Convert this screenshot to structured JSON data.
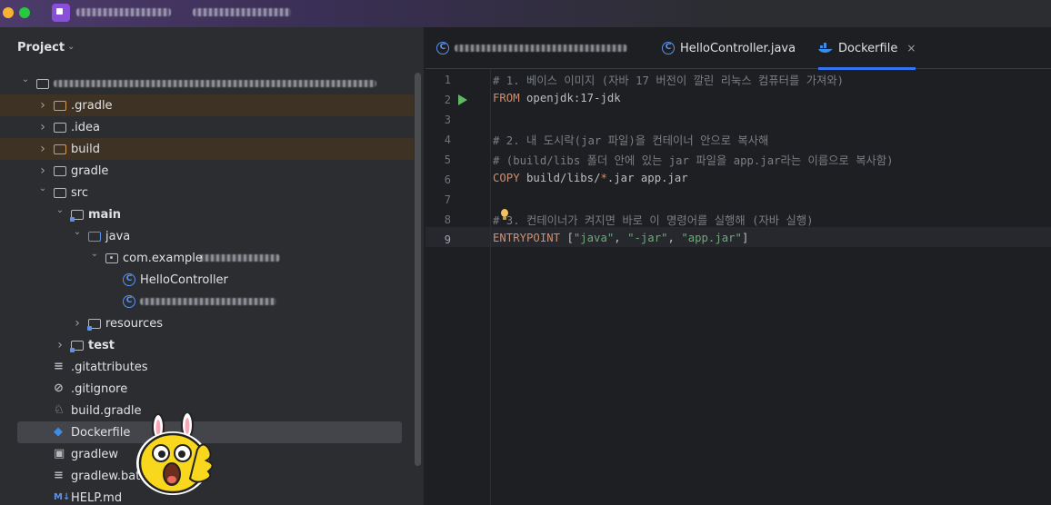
{
  "titlebar": {
    "project_badge_color": "#8a4fd8"
  },
  "panel": {
    "title": "Project",
    "chevron": "⌄"
  },
  "tree": [
    {
      "id": "root",
      "label": "",
      "depth": 0,
      "kind": "root",
      "expanded": true
    },
    {
      "id": "gradle-hidden",
      "label": ".gradle",
      "depth": 1,
      "kind": "folder-orange",
      "expanded": false,
      "highlight": "brown"
    },
    {
      "id": "idea",
      "label": ".idea",
      "depth": 1,
      "kind": "folder-plain",
      "expanded": false
    },
    {
      "id": "build",
      "label": "build",
      "depth": 1,
      "kind": "folder-orange",
      "expanded": false,
      "highlight": "brown"
    },
    {
      "id": "gradle",
      "label": "gradle",
      "depth": 1,
      "kind": "folder-plain",
      "expanded": false
    },
    {
      "id": "src",
      "label": "src",
      "depth": 1,
      "kind": "folder-plain",
      "expanded": true
    },
    {
      "id": "main",
      "label": "main",
      "depth": 2,
      "kind": "folder-module",
      "expanded": true,
      "bold": true
    },
    {
      "id": "java",
      "label": "java",
      "depth": 3,
      "kind": "folder-blue",
      "expanded": true
    },
    {
      "id": "pkg",
      "label": "com.example",
      "depth": 4,
      "kind": "package",
      "expanded": true
    },
    {
      "id": "hello",
      "label": "HelloController",
      "depth": 5,
      "kind": "class"
    },
    {
      "id": "app",
      "label": "",
      "depth": 5,
      "kind": "class-app"
    },
    {
      "id": "resources",
      "label": "resources",
      "depth": 3,
      "kind": "folder-res",
      "expanded": false
    },
    {
      "id": "test",
      "label": "test",
      "depth": 2,
      "kind": "folder-module",
      "expanded": false,
      "bold": true
    },
    {
      "id": "gitattributes",
      "label": ".gitattributes",
      "depth": 1,
      "kind": "file-text"
    },
    {
      "id": "gitignore",
      "label": ".gitignore",
      "depth": 1,
      "kind": "file-ignore"
    },
    {
      "id": "buildgradle",
      "label": "build.gradle",
      "depth": 1,
      "kind": "file-gradle"
    },
    {
      "id": "dockerfile",
      "label": "Dockerfile",
      "depth": 1,
      "kind": "file-docker",
      "selected": true
    },
    {
      "id": "gradlew",
      "label": "gradlew",
      "depth": 1,
      "kind": "file-shell"
    },
    {
      "id": "gradlewbat",
      "label": "gradlew.bat",
      "depth": 1,
      "kind": "file-text"
    },
    {
      "id": "helpmd",
      "label": "HELP.md",
      "depth": 1,
      "kind": "file-md"
    }
  ],
  "tabs": [
    {
      "label": "",
      "icon": "class-app-icon"
    },
    {
      "label": "HelloController.java",
      "icon": "class-icon"
    },
    {
      "label": "Dockerfile",
      "icon": "docker-icon",
      "active": true,
      "close": "×"
    }
  ],
  "editor": {
    "current_line": 9,
    "lines": [
      {
        "n": "1",
        "tokens": [
          {
            "t": "cmt",
            "v": "# 1. 베이스 이미지 (자바 17 버전이 깔린 리눅스 컴퓨터를 가져와)"
          }
        ]
      },
      {
        "n": "2",
        "run": true,
        "tokens": [
          {
            "t": "kw",
            "v": "FROM "
          },
          {
            "t": "plain",
            "v": "openjdk:17-jdk"
          }
        ]
      },
      {
        "n": "3",
        "tokens": []
      },
      {
        "n": "4",
        "tokens": [
          {
            "t": "cmt",
            "v": "# 2. 내 도시락(jar 파일)을 컨테이너 안으로 복사해"
          }
        ]
      },
      {
        "n": "5",
        "tokens": [
          {
            "t": "cmt",
            "v": "# (build/libs 폴더 안에 있는 jar 파일을 app.jar라는 이름으로 복사함)"
          }
        ]
      },
      {
        "n": "6",
        "tokens": [
          {
            "t": "kw",
            "v": "COPY "
          },
          {
            "t": "plain",
            "v": "build/libs/"
          },
          {
            "t": "kw",
            "v": "*"
          },
          {
            "t": "plain",
            "v": ".jar app.jar"
          }
        ]
      },
      {
        "n": "7",
        "tokens": []
      },
      {
        "n": "8",
        "tokens": [
          {
            "t": "cmt",
            "v": "# 3. 컨테이너가 켜지면 바로 이 명령어를 실행해 (자바 실행)"
          }
        ]
      },
      {
        "n": "9",
        "tokens": [
          {
            "t": "kw",
            "v": "ENTRYPOINT "
          },
          {
            "t": "plain",
            "v": "["
          },
          {
            "t": "str",
            "v": "\"java\""
          },
          {
            "t": "plain",
            "v": ", "
          },
          {
            "t": "str",
            "v": "\"-jar\""
          },
          {
            "t": "plain",
            "v": ", "
          },
          {
            "t": "str",
            "v": "\"app.jar\""
          },
          {
            "t": "plain",
            "v": "]"
          }
        ]
      }
    ]
  },
  "colors": {
    "accent": "#3574f0",
    "keyword": "#cf8e6d",
    "string": "#6aab73",
    "comment": "#7a7e85"
  }
}
